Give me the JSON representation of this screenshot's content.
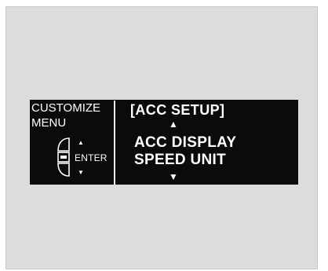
{
  "display": {
    "left": {
      "title_line1": "CUSTOMIZE",
      "title_line2": "MENU",
      "enter_label": "ENTER",
      "up_arrow": "▲",
      "down_arrow": "▼"
    },
    "right": {
      "heading": "[ACC SETUP]",
      "up_arrow": "▲",
      "items": [
        "ACC DISPLAY",
        "SPEED UNIT"
      ],
      "down_arrow": "▼"
    }
  },
  "colors": {
    "screen_bg": "#0b0b0b",
    "panel_bg": "#dcdcdc",
    "text": "#ffffff"
  },
  "icons": [
    "steering-switch-icon"
  ]
}
